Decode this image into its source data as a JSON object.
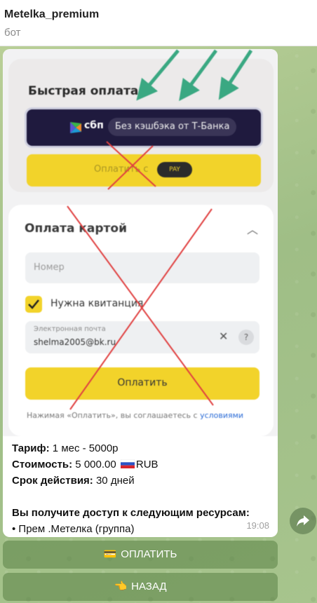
{
  "header": {
    "title": "Metelka_premium",
    "subtitle": "бот"
  },
  "screenshot": {
    "quick_pay_title": "Быстрая оплата",
    "sbp_label": "сбп",
    "sbp_pill": "Без кэшбэка от Т-Банка",
    "yellow_pay_text": "Оплатить с",
    "yellow_pay_badge": "PAY",
    "card_title": "Оплата картой",
    "card_number_placeholder": "Номер",
    "receipt_label": "Нужна квитанция",
    "email_label": "Электронная почта",
    "email_value": "shelma2005@bk.ru",
    "pay_button": "Оплатить",
    "terms_text": "Нажимая «Оплатить», вы соглашаетесь с ",
    "terms_link": "условиями"
  },
  "message": {
    "tariff_label": "Тариф:",
    "tariff_value": " 1 мес - 5000р",
    "cost_label": "Стоимость:",
    "cost_value": " 5 000.00 ",
    "cost_currency": "RUB",
    "term_label": "Срок действия:",
    "term_value": " 30 дней",
    "access_heading": "Вы получите доступ к следующим ресурсам:",
    "resource_item": "• Прем .Метелка (группа)",
    "time": "19:08"
  },
  "keyboard": {
    "pay": {
      "icon": "💳",
      "label": "ОПЛАТИТЬ"
    },
    "back": {
      "icon": "👈",
      "label": "НАЗАД"
    }
  },
  "colors": {
    "accent_yellow": "#f2d32a",
    "sbp_dark": "#1f1a3e",
    "arrow_green": "#3aa882",
    "cross_red": "#e04040"
  }
}
